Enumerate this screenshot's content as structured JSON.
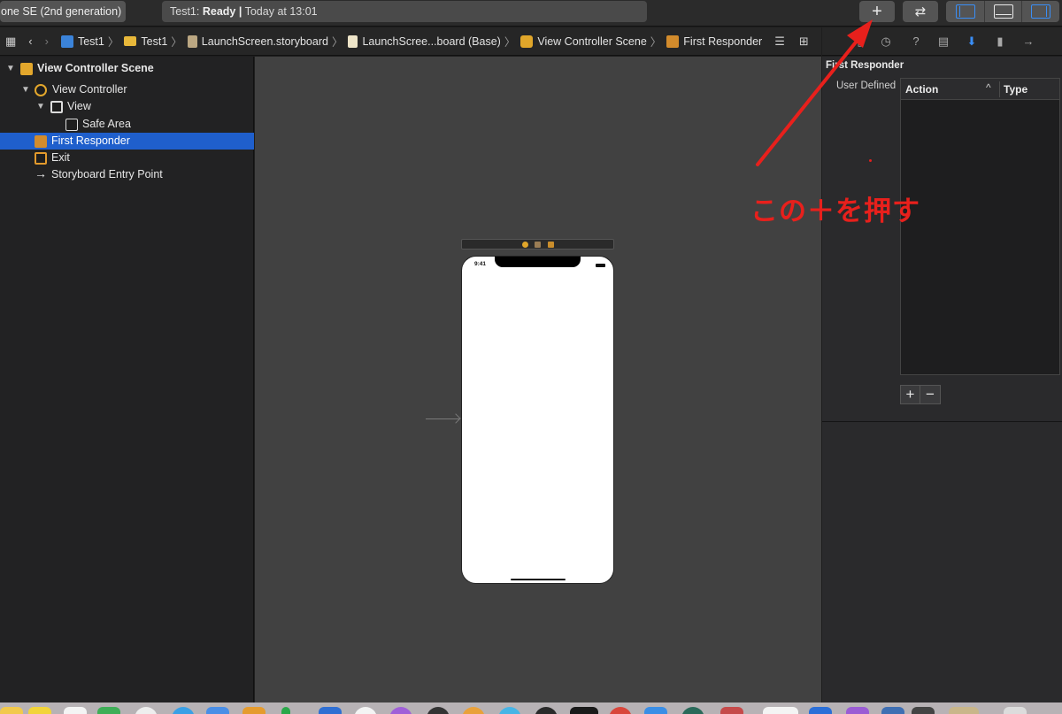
{
  "toolbar": {
    "scheme": "one SE (2nd generation)",
    "activity_project": "Test1:",
    "activity_state": "Ready",
    "activity_sep": "|",
    "activity_time": "Today at 13:01",
    "library_button": "+",
    "swap_button": "⇄"
  },
  "jumpbar": {
    "crumbs": [
      "Test1",
      "Test1",
      "LaunchScreen.storyboard",
      "LaunchScree...board (Base)",
      "View Controller Scene",
      "First Responder"
    ],
    "separator": "〉"
  },
  "outline": {
    "items": [
      {
        "label": "View Controller Scene"
      },
      {
        "label": "View Controller"
      },
      {
        "label": "View"
      },
      {
        "label": "Safe Area"
      },
      {
        "label": "First Responder"
      },
      {
        "label": "Exit"
      },
      {
        "label": "Storyboard Entry Point"
      }
    ]
  },
  "canvas": {
    "status_time": "9:41"
  },
  "inspector": {
    "title": "First Responder",
    "user_defined_label": "User Defined",
    "columns": {
      "action": "Action",
      "type": "Type"
    },
    "sort_indicator": "^",
    "add_label": "+",
    "remove_label": "−"
  },
  "annotation": {
    "text": "この＋を押す",
    "color": "#e8201c"
  },
  "colors": {
    "selection": "#1f5fcc",
    "accent": "#3a8ef6"
  }
}
